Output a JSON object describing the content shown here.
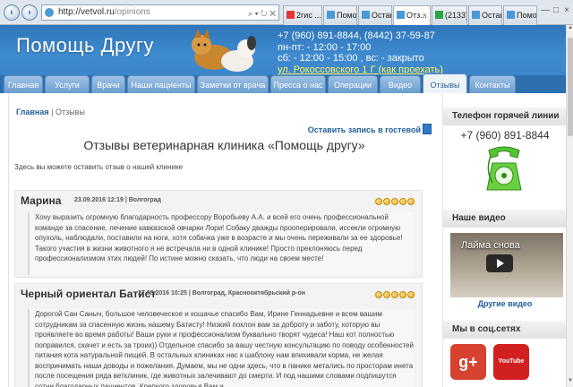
{
  "browser": {
    "url_host": "http://vetvol.ru",
    "url_path": "/opinions",
    "addr_tools": "⌕ ▾ ↻ ✕",
    "back": "‹",
    "forward": "›",
    "tabs": [
      {
        "label": "2гис ...",
        "icon_color": "#e53935"
      },
      {
        "label": "Помо...",
        "icon_color": "#4a9ad8"
      },
      {
        "label": "Остав...",
        "icon_color": "#4a9ad8"
      },
      {
        "label": "Отз...",
        "icon_color": "#4a9ad8"
      },
      {
        "label": "(2133) ...",
        "icon_color": "#2aa54a"
      },
      {
        "label": "Остав...",
        "icon_color": "#4a9ad8"
      },
      {
        "label": "Помо...",
        "icon_color": "#4a9ad8"
      }
    ],
    "tab_close": "×",
    "win_buttons": [
      "—",
      "□",
      "×"
    ]
  },
  "header": {
    "title": "Помощь Другу",
    "lines": [
      "+7 (960) 891-8844, (8442) 37-59-87",
      "пн-пт: - 12:00 - 17:00",
      "сб: - 12:00 - 15:00 , вс: - закрыто"
    ],
    "address": "ул. Рокоссовского 1 Г (как проехать)"
  },
  "nav": [
    "Главная",
    "Услуги",
    "Врачи",
    "Наши пациенты",
    "Заметки от врача",
    "Пресса о нас",
    "Операции",
    "Видео",
    "Отзывы",
    "Контакты"
  ],
  "content": {
    "breadcrumb_home": "Главная",
    "breadcrumb_sep": " | ",
    "breadcrumb_current": "Отзывы",
    "guest_link": "Оставить запись в гостевой",
    "heading": "Отзывы ветеринарная клиника «Помощь другу»",
    "intro": "Здесь вы можете оставить отзыв о нашей клинике",
    "reviews": [
      {
        "name": "Марина",
        "meta": "23.09.2016 12:19 | Волгоград",
        "stars": 5,
        "text": "Хочу выразить огромную благодарность профессору Воробьеву А.А. и всей его очень профессиональной команде за спасение, лечение кавказской овчарки Лори! Собаку дважды прооперировали, иссекли огромную опухоль, наблюдали, поставили на ноги, хотя собачка уже в возрасте и мы очень переживали за ее здоровье! Такого участия в жизни животного я не встречала ни в одной клинике! Просто преклоняюсь перед профессионализмом этих людей! По истине можно сказать, что люди на своем месте!"
      },
      {
        "name": "Черный ориентал Батист",
        "meta": "27.08.2016 10:25 | Волгоград, Краснооктябрьский р-он",
        "stars": 5,
        "text": "Дорогой Сан Саныч, большое человеческое и кошачье спасибо Вам, Ирине Геннадьевне и всем вашим сотрудникам за спасенную жизнь нашему Батисту! Низкий поклон вам за доброту и заботу, которую вы проявляете во время работы! Ваши руки и профессионализм буквально творят чудеса! Наш кот полностью поправился, скачет и есть за троих)) Отдельное спасибо за вашу честную консультацию по поводу особенностей питания кота натуральной пищей. В остальных клиниках нас к шаблону нам впихивали корма, не желая воспринимать наши доводы и пожелания. Думаем, мы не одни здесь, что в панике метались по просторам инета после посещения ряда ветклиник, где животных залечивают до смерти. И под нашими словами подпишутся сотни благодарных пациентов. Крепкого здоровья Вам и"
      }
    ]
  },
  "sidebar": {
    "hotline_title": "Телефон горячей линии",
    "hotline_phone": "+7 (960) 891-8844",
    "video_title": "Наше видео",
    "video_thumb_title": "Лайма снова",
    "video_link": "Другие видео",
    "social_title": "Мы в соц.сетях",
    "gplus_label": "g+",
    "youtube_label": "YouTube"
  },
  "colors": {
    "header_blue": "#3f8bd0",
    "nav_dark": "#2d6fae",
    "link_blue": "#1f5e9b",
    "address_yellow": "#fff35a",
    "star_gold": "#e8a915"
  }
}
